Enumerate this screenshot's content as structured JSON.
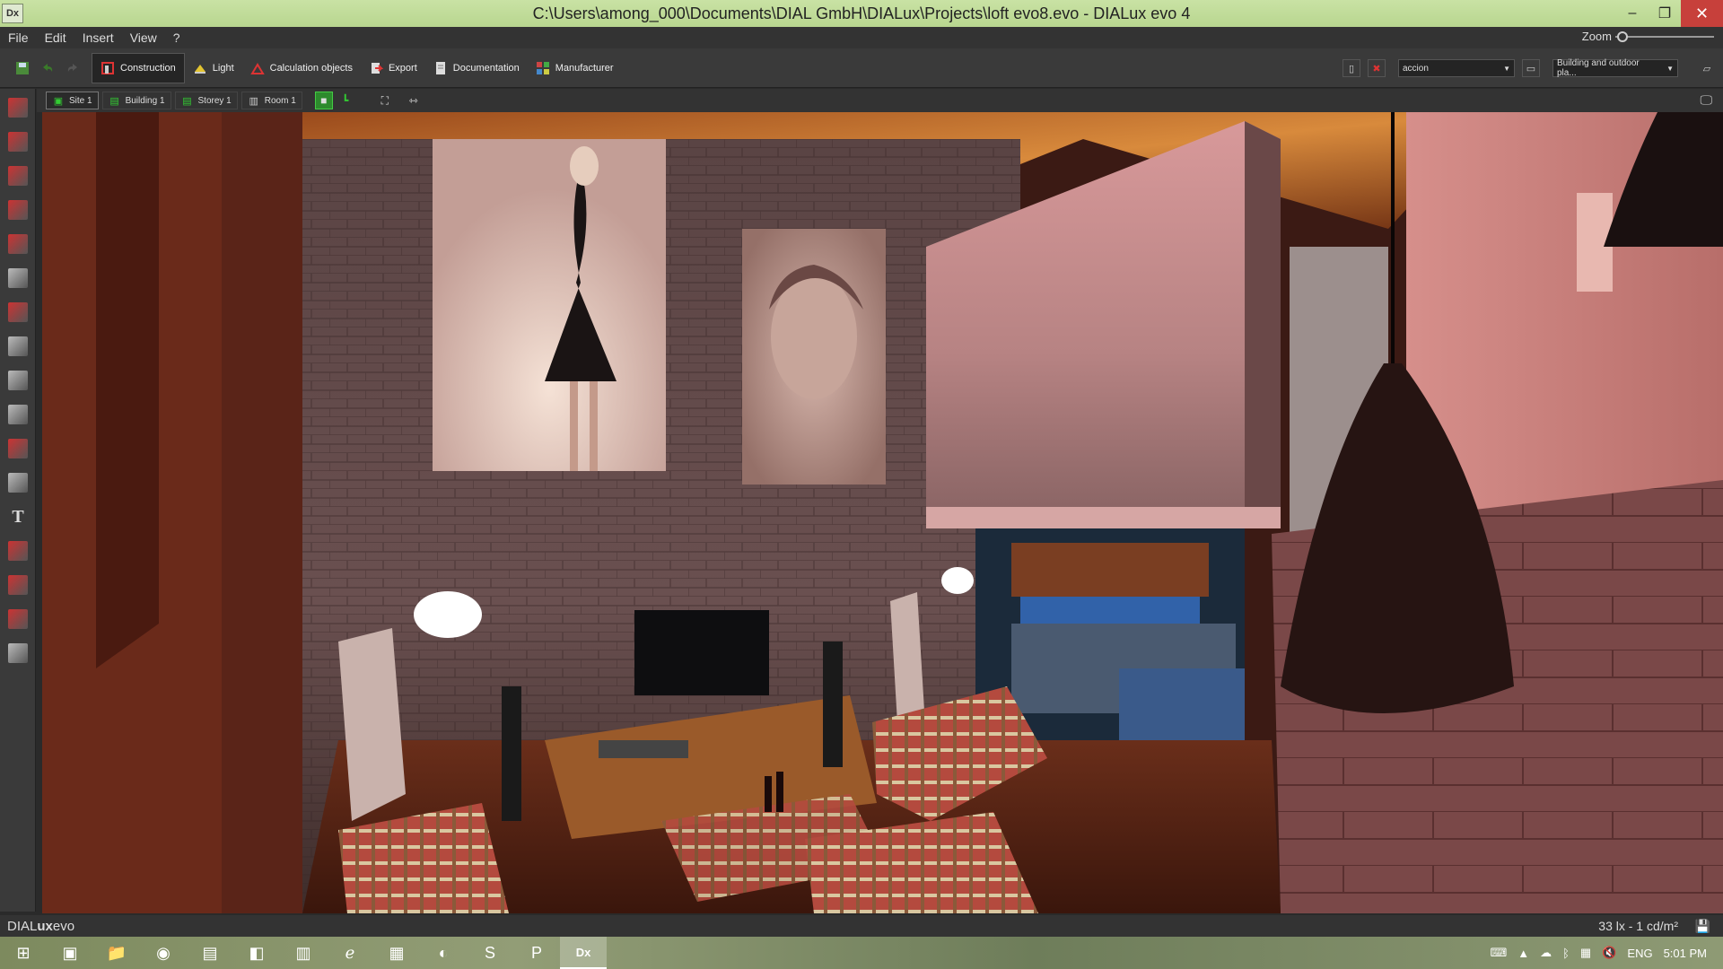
{
  "window": {
    "app_icon_label": "Dx",
    "title": "C:\\Users\\among_000\\Documents\\DIAL GmbH\\DIALux\\Projects\\loft evo8.evo - DIALux evo 4",
    "minimize_glyph": "–",
    "restore_glyph": "❐",
    "close_glyph": "✕"
  },
  "menu": {
    "items": [
      "File",
      "Edit",
      "Insert",
      "View",
      "?"
    ],
    "zoom_label": "Zoom",
    "zoom_level": 0.02
  },
  "toolbar": {
    "tabs": [
      {
        "label": "Construction",
        "icon": "construction-icon",
        "active": true
      },
      {
        "label": "Light",
        "icon": "light-icon",
        "active": false
      },
      {
        "label": "Calculation objects",
        "icon": "calculation-objects-icon",
        "active": false
      },
      {
        "label": "Export",
        "icon": "export-icon",
        "active": false
      },
      {
        "label": "Documentation",
        "icon": "documentation-icon",
        "active": false
      },
      {
        "label": "Manufacturer",
        "icon": "manufacturer-icon",
        "active": false
      }
    ],
    "scene_select": "accion",
    "view_select": "Building and outdoor pla..."
  },
  "object_bar": {
    "crumbs": [
      {
        "label": "Site 1",
        "icon": "site-icon"
      },
      {
        "label": "Building 1",
        "icon": "building-icon"
      },
      {
        "label": "Storey 1",
        "icon": "storey-icon"
      },
      {
        "label": "Room 1",
        "icon": "room-icon"
      }
    ]
  },
  "left_tools": [
    "draw-wall-icon",
    "draw-door-icon",
    "draw-room-icon",
    "draw-storey-icon",
    "draw-site-icon",
    "cube-elements-icon",
    "roof-icon",
    "box-icon",
    "extrude-icon",
    "staircase-icon",
    "material-icon",
    "dimension-icon",
    "text-tool-icon",
    "polyline-icon",
    "colors-icon",
    "section-icon",
    "grid-tool-icon"
  ],
  "status": {
    "brand_prefix": "DIAL",
    "brand_bold": "ux",
    "brand_suffix": "evo",
    "lux_readout": "33 lx - 1 cd/m²",
    "save_glyph": "💾"
  },
  "taskbar": {
    "apps": [
      {
        "name": "windows-start-icon",
        "glyph": "⊞"
      },
      {
        "name": "explorer-window-icon",
        "glyph": "▣"
      },
      {
        "name": "file-explorer-icon",
        "glyph": "📁"
      },
      {
        "name": "chrome-icon",
        "glyph": "◉"
      },
      {
        "name": "photos-icon",
        "glyph": "▤"
      },
      {
        "name": "app-icon",
        "glyph": "◧"
      },
      {
        "name": "notepad-icon",
        "glyph": "▥"
      },
      {
        "name": "internet-explorer-icon",
        "glyph": "ℯ"
      },
      {
        "name": "flag-app-icon",
        "glyph": "▦"
      },
      {
        "name": "settings-app-icon",
        "glyph": "◐"
      },
      {
        "name": "skype-icon",
        "glyph": "S"
      },
      {
        "name": "powerpoint-icon",
        "glyph": "P"
      },
      {
        "name": "dialux-taskbar-icon",
        "glyph": "Dx"
      }
    ],
    "language": "ENG",
    "clock": "5:01 PM"
  }
}
